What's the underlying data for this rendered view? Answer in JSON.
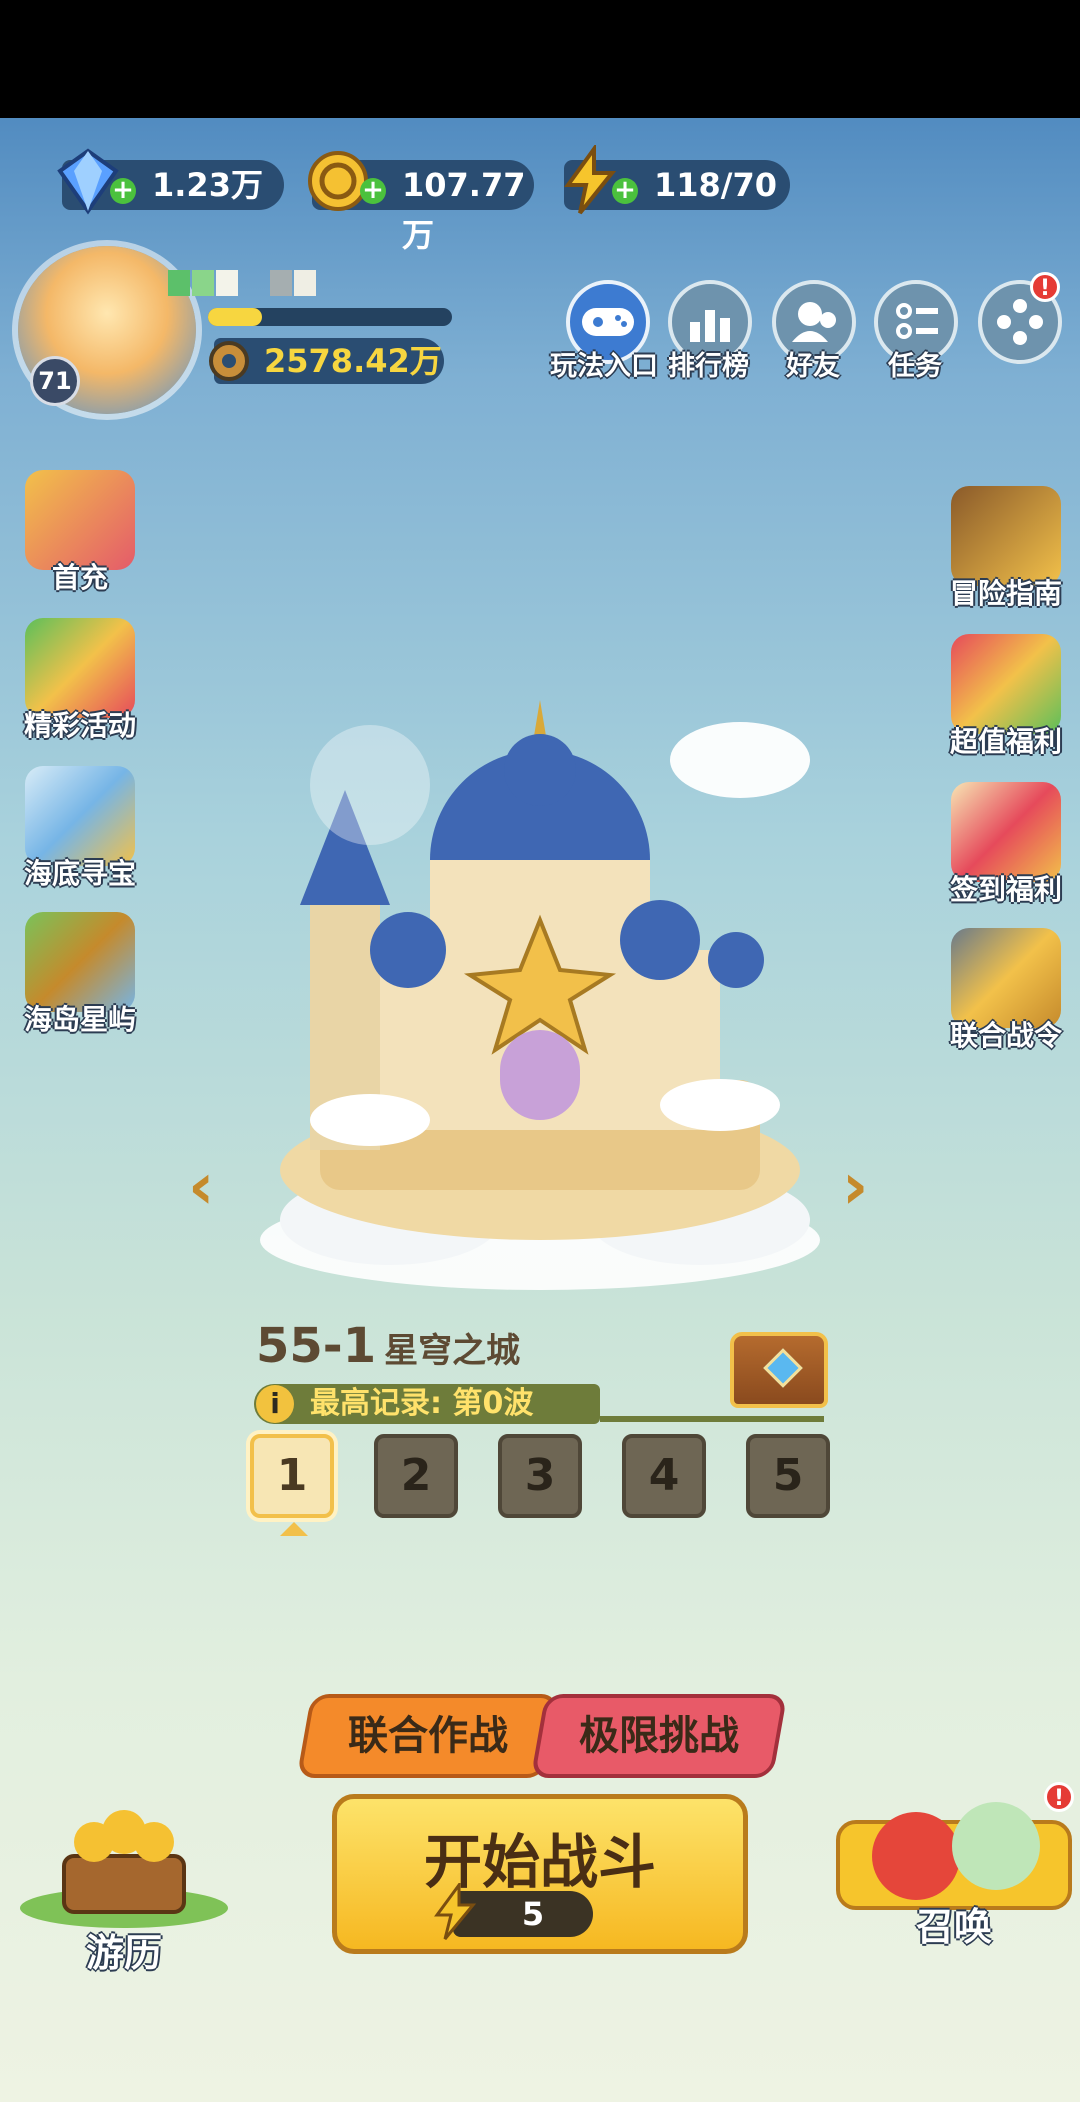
{
  "resources": {
    "diamonds": "1.23万",
    "coins": "107.77万",
    "energy": "118/70"
  },
  "player": {
    "level": "71",
    "xp_fraction": 0.22,
    "gold": "2578.42万"
  },
  "top_nav": [
    {
      "label": "玩法入口",
      "icon": "gamepad-icon"
    },
    {
      "label": "排行榜",
      "icon": "leaderboard-icon"
    },
    {
      "label": "好友",
      "icon": "friends-icon"
    },
    {
      "label": "任务",
      "icon": "task-icon"
    },
    {
      "label": "",
      "icon": "more-icon"
    }
  ],
  "left_menu": [
    "首充",
    "精彩活动",
    "海底寻宝",
    "海岛星屿"
  ],
  "right_menu": [
    "冒险指南",
    "超值福利",
    "签到福利",
    "联合战令"
  ],
  "stage": {
    "number": "55-1",
    "name": "星穹之城",
    "record": "最高记录: 第0波"
  },
  "waves": [
    "1",
    "2",
    "3",
    "4",
    "5"
  ],
  "selected_wave": 0,
  "modes": {
    "coop": "联合作战",
    "extreme": "极限挑战"
  },
  "start": {
    "label": "开始战斗",
    "cost": "5"
  },
  "bottom": {
    "travel": "游历",
    "summon": "召唤"
  },
  "badge_symbol": "!",
  "colors": {
    "accent_gold": "#f6b821",
    "coop_orange": "#f48a2a",
    "extreme_red": "#e85a68"
  }
}
